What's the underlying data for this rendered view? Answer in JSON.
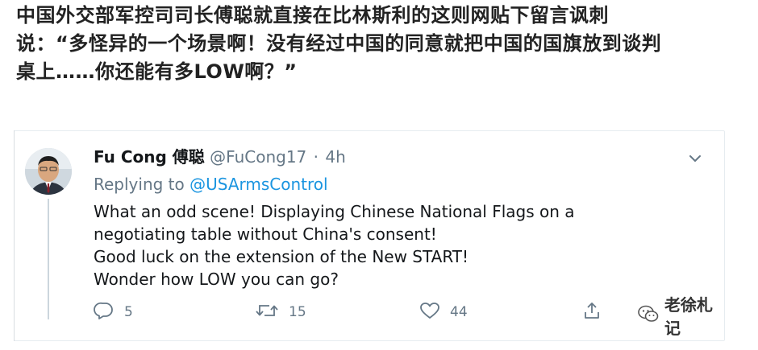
{
  "caption": {
    "line1": "中国外交部军控司司长傅聪就直接在比林斯利的这则网贴下留言讽刺",
    "line2": "说：“多怪异的一个场景啊！没有经过中国的同意就把中国的国旗放到谈判",
    "line3": "桌上……你还能有多LOW啊？”"
  },
  "tweet": {
    "display_name": "Fu Cong 傅聪",
    "handle": "@FuCong17",
    "separator": "·",
    "time": "4h",
    "replying_prefix": "Replying to ",
    "replying_to": "@USArmsControl",
    "body": [
      "What an odd scene! Displaying Chinese National Flags on a",
      "negotiating table without China's consent!",
      "Good luck on the extension of the New START!",
      "Wonder how LOW you can go?"
    ],
    "replies": "5",
    "retweets": "15",
    "likes": "44"
  },
  "watermark": {
    "text": "老徐札记"
  },
  "icons": {
    "chevron": "chevron-down-icon",
    "reply": "reply-icon",
    "retweet": "retweet-icon",
    "like": "heart-icon",
    "share": "share-icon",
    "wechat": "wechat-icon"
  },
  "colors": {
    "link": "#1b95e0",
    "muted": "#657786",
    "text": "#14171a"
  }
}
